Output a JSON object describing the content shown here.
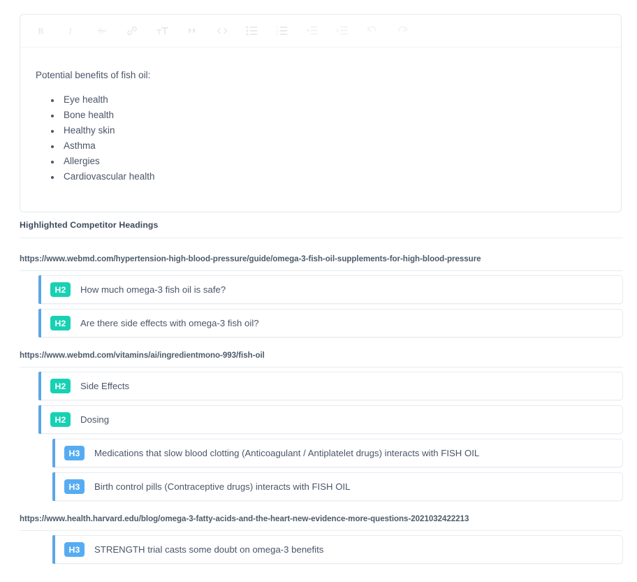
{
  "editor": {
    "toolbar": [
      {
        "name": "bold-icon",
        "label": "Bold",
        "disabled": false
      },
      {
        "name": "italic-icon",
        "label": "Italic",
        "disabled": false
      },
      {
        "name": "strikethrough-icon",
        "label": "Strikethrough",
        "disabled": false
      },
      {
        "name": "link-icon",
        "label": "Link",
        "disabled": false
      },
      {
        "name": "text-size-icon",
        "label": "Text size",
        "disabled": false
      },
      {
        "name": "blockquote-icon",
        "label": "Quote",
        "disabled": false
      },
      {
        "name": "code-icon",
        "label": "Code",
        "disabled": false
      },
      {
        "name": "bulleted-list-icon",
        "label": "Bulleted list",
        "disabled": false
      },
      {
        "name": "numbered-list-icon",
        "label": "Numbered list",
        "disabled": false
      },
      {
        "name": "outdent-icon",
        "label": "Decrease indent",
        "disabled": true
      },
      {
        "name": "indent-icon",
        "label": "Increase indent",
        "disabled": true
      },
      {
        "name": "undo-icon",
        "label": "Undo",
        "disabled": true
      },
      {
        "name": "redo-icon",
        "label": "Redo",
        "disabled": true
      }
    ],
    "paragraph": "Potential benefits of fish oil:",
    "bullets": [
      "Eye health",
      "Bone health",
      "Healthy skin",
      "Asthma",
      "Allergies",
      "Cardiovascular health"
    ]
  },
  "section": {
    "title": "Highlighted Competitor Headings"
  },
  "colors": {
    "h2_badge": "#17d1b4",
    "h3_badge": "#56acf2",
    "accent_bar": "#5ba7e8",
    "text": "#4a5568",
    "card_border": "#e7ecf1"
  },
  "groups": [
    {
      "url": "https://www.webmd.com/hypertension-high-blood-pressure/guide/omega-3-fish-oil-supplements-for-high-blood-pressure",
      "headings": [
        {
          "level": "H2",
          "text": "How much omega-3 fish oil is safe?"
        },
        {
          "level": "H2",
          "text": "Are there side effects with omega-3 fish oil?"
        }
      ]
    },
    {
      "url": "https://www.webmd.com/vitamins/ai/ingredientmono-993/fish-oil",
      "headings": [
        {
          "level": "H2",
          "text": "Side Effects"
        },
        {
          "level": "H2",
          "text": "Dosing"
        },
        {
          "level": "H3",
          "text": "Medications that slow blood clotting (Anticoagulant / Antiplatelet drugs) interacts with FISH OIL"
        },
        {
          "level": "H3",
          "text": "Birth control pills (Contraceptive drugs) interacts with FISH OIL"
        }
      ]
    },
    {
      "url": "https://www.health.harvard.edu/blog/omega-3-fatty-acids-and-the-heart-new-evidence-more-questions-2021032422213",
      "headings": [
        {
          "level": "H3",
          "text": "STRENGTH trial casts some doubt on omega-3 benefits"
        }
      ]
    }
  ]
}
